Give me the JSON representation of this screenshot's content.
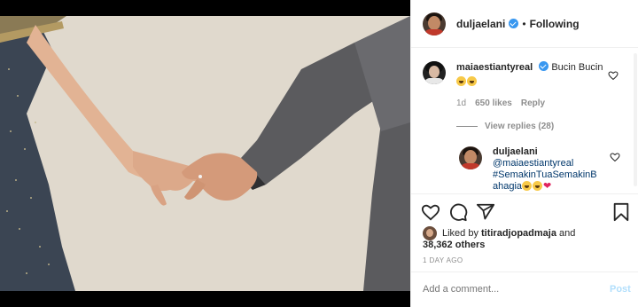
{
  "post": {
    "author": "duljaelani",
    "dot": "•",
    "following_label": "Following"
  },
  "comments": [
    {
      "user": "maiaestiantyreal",
      "text": "Bucin Bucin",
      "emojis": [
        "grinning-squint-face",
        "grinning-squint-face"
      ],
      "age": "1d",
      "likes": "650 likes",
      "reply_label": "Reply",
      "view_replies": "View replies (28)"
    },
    {
      "user": "duljaelani",
      "mention": "@maiaestiantyreal",
      "hashtag": "#SemakinTuaSemakinBahagia",
      "emojis": [
        "grinning-squint-face",
        "grinning-squint-face",
        "red-heart"
      ]
    }
  ],
  "liked_by": {
    "prefix": "Liked by",
    "user": "titiradjopadmaja",
    "suffix": "and",
    "count": "38,362",
    "count_suffix": "others"
  },
  "timestamp": "1 DAY AGO",
  "add_comment": {
    "placeholder": "Add a comment...",
    "post_label": "Post"
  },
  "colors": {
    "verified": "#3897f0",
    "link": "#00376b",
    "post_disabled": "#b2dffc",
    "muted": "#8e8e8e"
  },
  "icons": [
    "verified-badge-icon",
    "heart-icon",
    "comment-icon",
    "share-icon",
    "bookmark-icon"
  ]
}
